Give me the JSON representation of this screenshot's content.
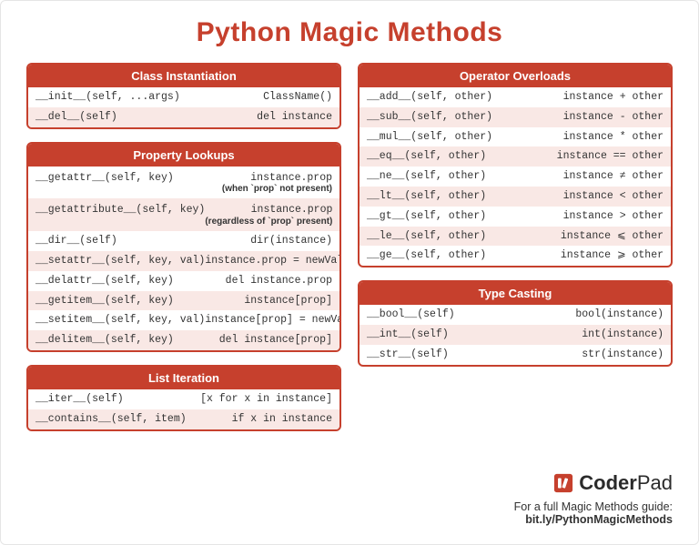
{
  "title": "Python Magic Methods",
  "sections": {
    "class_instantiation": {
      "header": "Class Instantiation",
      "rows": [
        {
          "l": "__init__(self, ...args)",
          "r": "ClassName()"
        },
        {
          "l": "__del__(self)",
          "r": "del instance"
        }
      ]
    },
    "property_lookups": {
      "header": "Property Lookups",
      "rows": [
        {
          "l": "__getattr__(self, key)",
          "r": "instance.prop",
          "note": "(when `prop` not present)"
        },
        {
          "l": "__getattribute__(self, key)",
          "r": "instance.prop",
          "note": "(regardless of `prop` present)"
        },
        {
          "l": "__dir__(self)",
          "r": "dir(instance)"
        },
        {
          "l": "__setattr__(self, key, val)",
          "r": "instance.prop = newVal"
        },
        {
          "l": "__delattr__(self, key)",
          "r": "del instance.prop"
        },
        {
          "l": "__getitem__(self, key)",
          "r": "instance[prop]"
        },
        {
          "l": "__setitem__(self, key, val)",
          "r": "instance[prop] = newVal"
        },
        {
          "l": "__delitem__(self, key)",
          "r": "del instance[prop]"
        }
      ]
    },
    "list_iteration": {
      "header": "List Iteration",
      "rows": [
        {
          "l": "__iter__(self)",
          "r": "[x for x in instance]"
        },
        {
          "l": "__contains__(self, item)",
          "r": "if x in instance"
        }
      ]
    },
    "operator_overloads": {
      "header": "Operator Overloads",
      "rows": [
        {
          "l": "__add__(self, other)",
          "r": "instance + other"
        },
        {
          "l": "__sub__(self, other)",
          "r": "instance - other"
        },
        {
          "l": "__mul__(self, other)",
          "r": "instance * other"
        },
        {
          "l": "__eq__(self, other)",
          "r": "instance == other"
        },
        {
          "l": "__ne__(self, other)",
          "r": "instance ≠ other"
        },
        {
          "l": "__lt__(self, other)",
          "r": "instance < other"
        },
        {
          "l": "__gt__(self, other)",
          "r": "instance > other"
        },
        {
          "l": "__le__(self, other)",
          "r": "instance ⩽ other"
        },
        {
          "l": "__ge__(self, other)",
          "r": "instance ⩾ other"
        }
      ]
    },
    "type_casting": {
      "header": "Type Casting",
      "rows": [
        {
          "l": "__bool__(self)",
          "r": "bool(instance)"
        },
        {
          "l": "__int__(self)",
          "r": "int(instance)"
        },
        {
          "l": "__str__(self)",
          "r": "str(instance)"
        }
      ]
    }
  },
  "footer": {
    "brand_bold": "Coder",
    "brand_light": "Pad",
    "line1": "For a full Magic Methods guide:",
    "line2": "bit.ly/PythonMagicMethods"
  }
}
